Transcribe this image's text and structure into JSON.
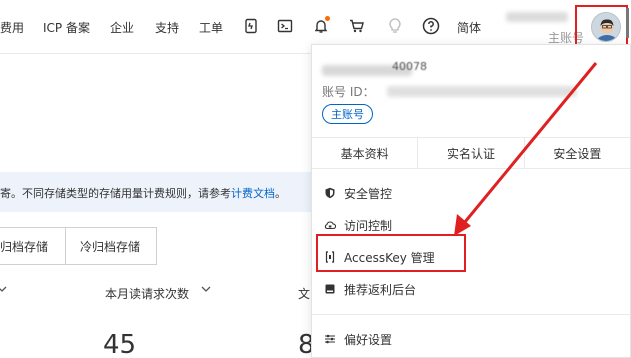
{
  "nav": {
    "items": [
      {
        "label": "费用"
      },
      {
        "label": "ICP 备案"
      },
      {
        "label": "企业"
      },
      {
        "label": "支持"
      },
      {
        "label": "工单"
      },
      {
        "label": "简体"
      }
    ],
    "icons": [
      "app-icon",
      "terminal-icon",
      "bell-icon",
      "cart-icon",
      "lightbulb-icon",
      "help-icon"
    ],
    "user": {
      "role": "主账号"
    }
  },
  "content": {
    "notice": {
      "text": "寄。不同存储类型的存储用量计费规则，请参考",
      "link": "计费文档",
      "suffix": "。"
    },
    "buttons": [
      "归档存储",
      "冷归档存储"
    ],
    "stats": [
      {
        "label": "本月读请求次数",
        "value": "45"
      },
      {
        "label": "文",
        "value": "8"
      }
    ]
  },
  "dropdown": {
    "uid_tail": "40078",
    "account_id_label": "账号 ID：",
    "badge": "主账号",
    "tabs": [
      "基本资料",
      "实名认证",
      "安全设置"
    ],
    "menu": [
      {
        "label": "安全管控",
        "icon": "shield-icon"
      },
      {
        "label": "访问控制",
        "icon": "cloud-lock-icon"
      },
      {
        "label": "AccessKey 管理",
        "icon": "key-icon"
      },
      {
        "label": "推荐返利后台",
        "icon": "card-icon"
      },
      {
        "label": "偏好设置",
        "icon": "sliders-icon"
      }
    ]
  },
  "colors": {
    "accent": "#0064c8",
    "annotation": "#e02020",
    "notification_dot": "#ff6a00"
  }
}
